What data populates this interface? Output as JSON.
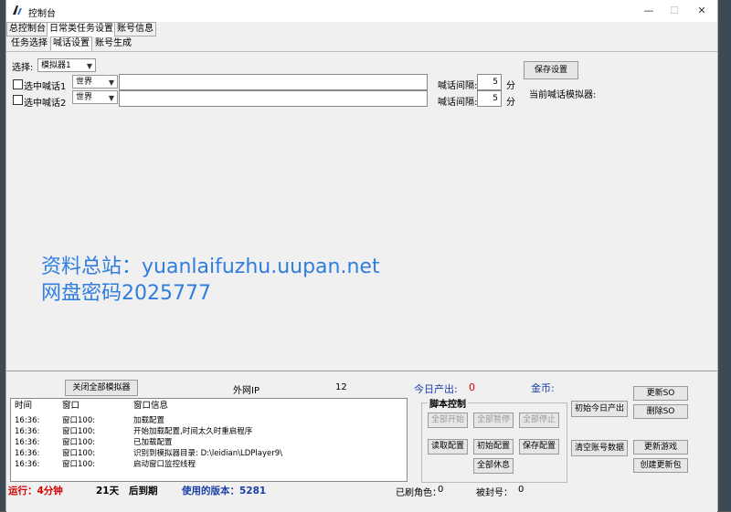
{
  "window": {
    "title": "控制台",
    "controls": [
      "—",
      "☐",
      "✕"
    ]
  },
  "main_tabs": [
    "总控制台",
    "日常类任务设置",
    "账号信息"
  ],
  "sub_tabs": [
    "任务选择",
    "喊话设置",
    "账号生成"
  ],
  "shout": {
    "select_label": "选择:",
    "emulator_selected": "模拟器1",
    "rows": [
      {
        "check_label": "选中喊话1",
        "channel": "世界",
        "text": "",
        "interval_label": "喊话间隔:",
        "interval": "5",
        "unit": "分"
      },
      {
        "check_label": "选中喊话2",
        "channel": "世界",
        "text": "",
        "interval_label": "喊话间隔:",
        "interval": "5",
        "unit": "分"
      }
    ],
    "save_button": "保存设置",
    "current_label": "当前喊话模拟器:"
  },
  "watermark": {
    "line1": "资料总站：yuanlaifuzhu.uupan.net",
    "line2": "网盘密码2025777"
  },
  "bottom": {
    "close_all_button": "关闭全部模拟器",
    "ext_ip_label": "外网IP",
    "ext_ip_value": "12",
    "today_label": "今日产出:",
    "today_value": "0",
    "gold_label": "金币:",
    "log_headers": [
      "时间",
      "窗口",
      "窗口信息"
    ],
    "log_rows": [
      {
        "time": "16:36:",
        "win": "窗口100:",
        "msg": "加载配置"
      },
      {
        "time": "16:36:",
        "win": "窗口100:",
        "msg": "开始加载配置,时间太久时重启程序"
      },
      {
        "time": "16:36:",
        "win": "窗口100:",
        "msg": "已加载配置"
      },
      {
        "time": "16:36:",
        "win": "窗口100:",
        "msg": "识别到模拟器目录: D:\\leidian\\LDPlayer9\\"
      },
      {
        "time": "16:36:",
        "win": "窗口100:",
        "msg": "启动窗口监控线程"
      }
    ],
    "script_control": "脚本控制",
    "script_buttons": {
      "start_all": "全部开始",
      "pause_all": "全部暂停",
      "stop_all": "全部停止",
      "read_config": "读取配置",
      "init_config": "初始配置",
      "save_config": "保存配置",
      "rest_all": "全部休息"
    },
    "right_buttons": {
      "init_today": "初始今日产出",
      "clear_accounts": "清空账号数据",
      "update_so": "更新SO",
      "delete_so": "删除SO",
      "update_game": "更新游戏",
      "create_pack": "创建更新包"
    },
    "status": {
      "running": "运行：4分钟",
      "days": "21天",
      "expiry": "后到期",
      "version_label": "使用的版本：5281",
      "refreshed_label": "已刷角色：",
      "refreshed_value": "0",
      "banned_label": "被封号：",
      "banned_value": "0"
    }
  },
  "colors": {
    "watermark": "#2f7de0",
    "accent_red": "#d40000",
    "accent_blue": "#1a3ea8"
  }
}
